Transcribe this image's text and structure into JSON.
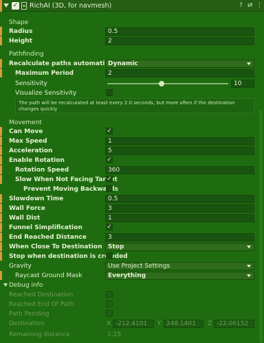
{
  "header": {
    "title": "RichAI (3D, for navmesh)"
  },
  "shape": {
    "section": "Shape",
    "radius_label": "Radius",
    "radius": "0.5",
    "height_label": "Height",
    "height": "2"
  },
  "pathfinding": {
    "section": "Pathfinding",
    "recalc_label": "Recalculate paths automatically",
    "recalc_value": "Dynamic",
    "max_period_label": "Maximum Period",
    "max_period": "2",
    "sensitivity_label": "Sensitivity",
    "sensitivity": "10",
    "sensitivity_fraction": 0.45,
    "visualize_label": "Visualize Sensitivity",
    "help_text": "The path will be recalculated at least every 2.0 seconds, but more often if the destination changes quickly"
  },
  "movement": {
    "section": "Movement",
    "can_move_label": "Can Move",
    "max_speed_label": "Max Speed",
    "max_speed": "1",
    "acceleration_label": "Acceleration",
    "acceleration": "5",
    "enable_rotation_label": "Enable Rotation",
    "rotation_speed_label": "Rotation Speed",
    "rotation_speed": "360",
    "slow_label": "Slow When Not Facing Target",
    "prevent_label": "Prevent Moving Backwards",
    "slowdown_label": "Slowdown Time",
    "slowdown": "0.5",
    "wall_force_label": "Wall Force",
    "wall_force": "3",
    "wall_dist_label": "Wall Dist",
    "wall_dist": "1",
    "funnel_label": "Funnel Simplification",
    "end_reached_label": "End Reached Distance",
    "end_reached": "3",
    "close_label": "When Close To Destination",
    "close_value": "Stop",
    "crowded_label": "Stop when destination is crowded",
    "gravity_label": "Gravity",
    "gravity_value": "Use Project Settings",
    "raycast_label": "Raycast Ground Mask",
    "raycast_value": "Everything"
  },
  "debug": {
    "section": "Debug info",
    "reached_dest_label": "Reached Destination",
    "reached_end_label": "Reached End Of Path",
    "pending_label": "Path Pending",
    "destination_label": "Destination",
    "x_label": "X",
    "x": "-212.4101",
    "y_label": "Y",
    "y": "248.1401",
    "z_label": "Z",
    "z": "-22.06152",
    "remaining_label": "Remaining distance",
    "remaining": "1.15"
  }
}
